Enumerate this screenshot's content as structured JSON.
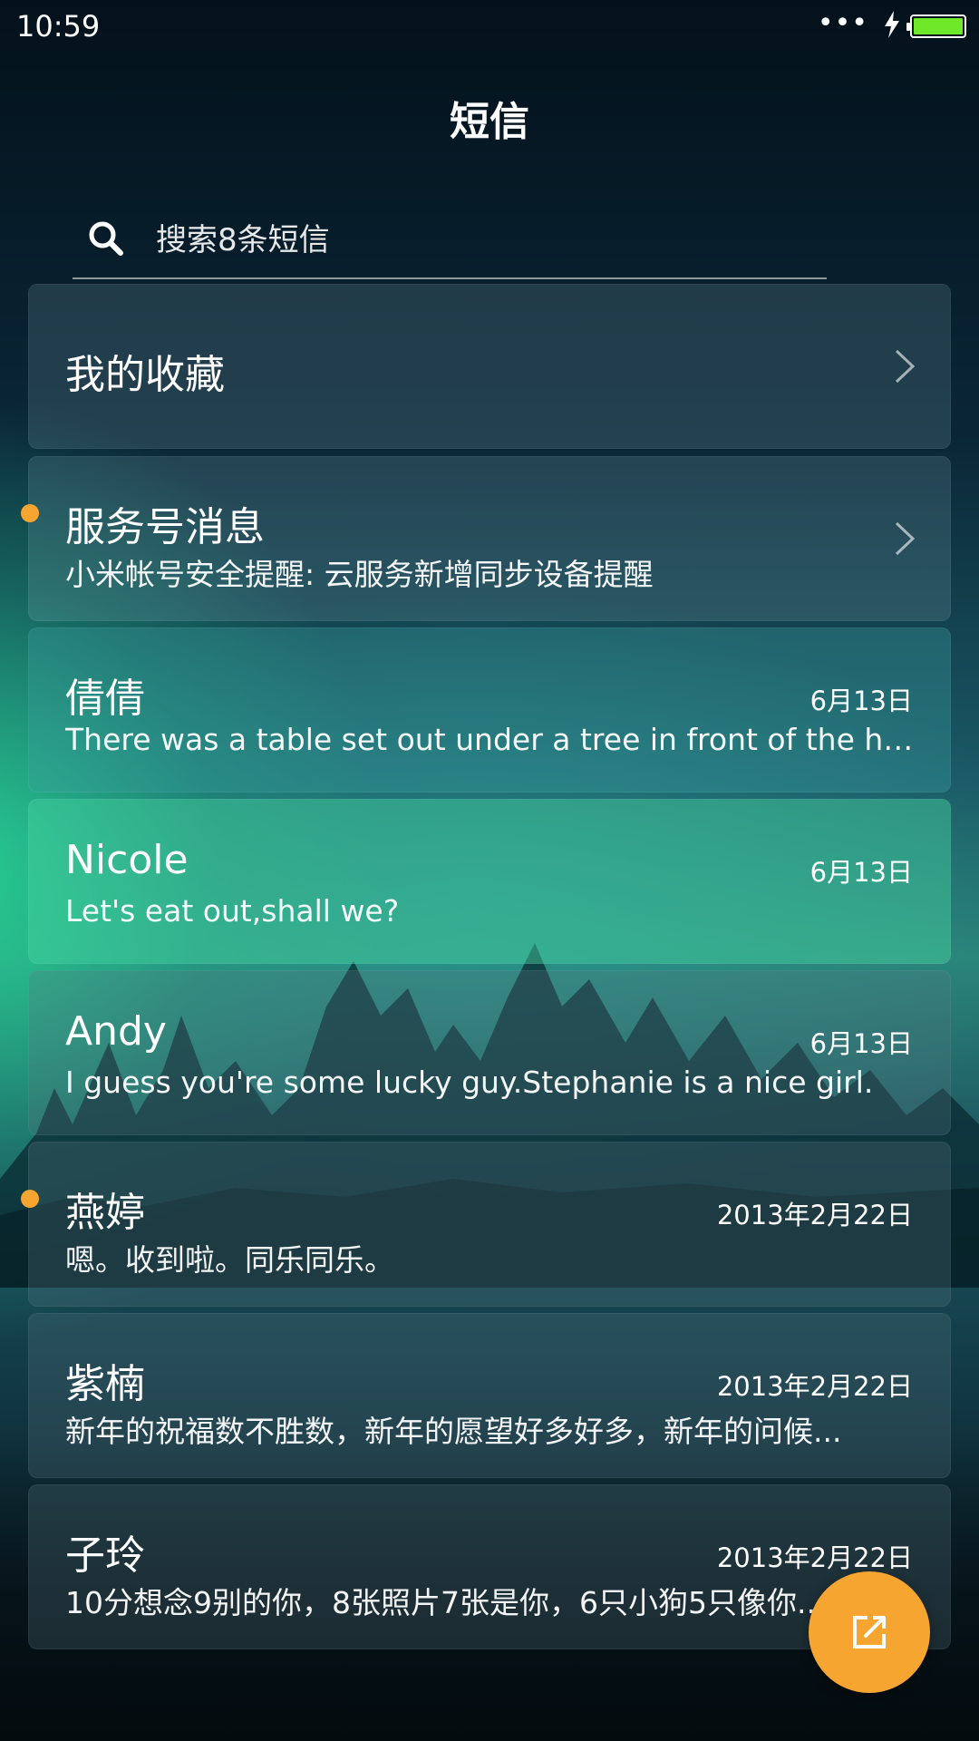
{
  "status_bar": {
    "time": "10:59",
    "dots": "•••",
    "icons": [
      "signal-dots-icon",
      "charging-bolt-icon",
      "battery-icon"
    ],
    "battery_level": 1.0,
    "battery_color": "#6fe82a"
  },
  "header": {
    "title": "短信"
  },
  "search": {
    "placeholder": "搜索8条短信",
    "icon": "search-icon"
  },
  "favorites": {
    "label": "我的收藏"
  },
  "service": {
    "title": "服务号消息",
    "preview": "小米帐号安全提醒: 云服务新增同步设备提醒",
    "unread": true
  },
  "conversations": [
    {
      "name": "倩倩",
      "date": "6月13日",
      "preview": "There was a table set out under a tree in front of the ho...",
      "unread": false
    },
    {
      "name": "Nicole",
      "date": "6月13日",
      "preview": "Let's eat out,shall we?",
      "unread": false
    },
    {
      "name": "Andy",
      "date": "6月13日",
      "preview": "I guess you're some lucky guy.Stephanie is a nice girl.",
      "unread": false
    },
    {
      "name": "燕婷",
      "date": "2013年2月22日",
      "preview": "嗯。收到啦。同乐同乐。",
      "unread": true
    },
    {
      "name": "紫楠",
      "date": "2013年2月22日",
      "preview": "新年的祝福数不胜数，新年的愿望好多好多，新年的问候...",
      "unread": false
    },
    {
      "name": "子玲",
      "date": "2013年2月22日",
      "preview": "10分想念9别的你，8张照片7张是你，6只小狗5只像你...",
      "unread": false
    }
  ],
  "fab": {
    "icon": "compose-icon",
    "color": "#f6a531"
  },
  "colors": {
    "accent": "#f6a531",
    "text": "#ffffff"
  }
}
